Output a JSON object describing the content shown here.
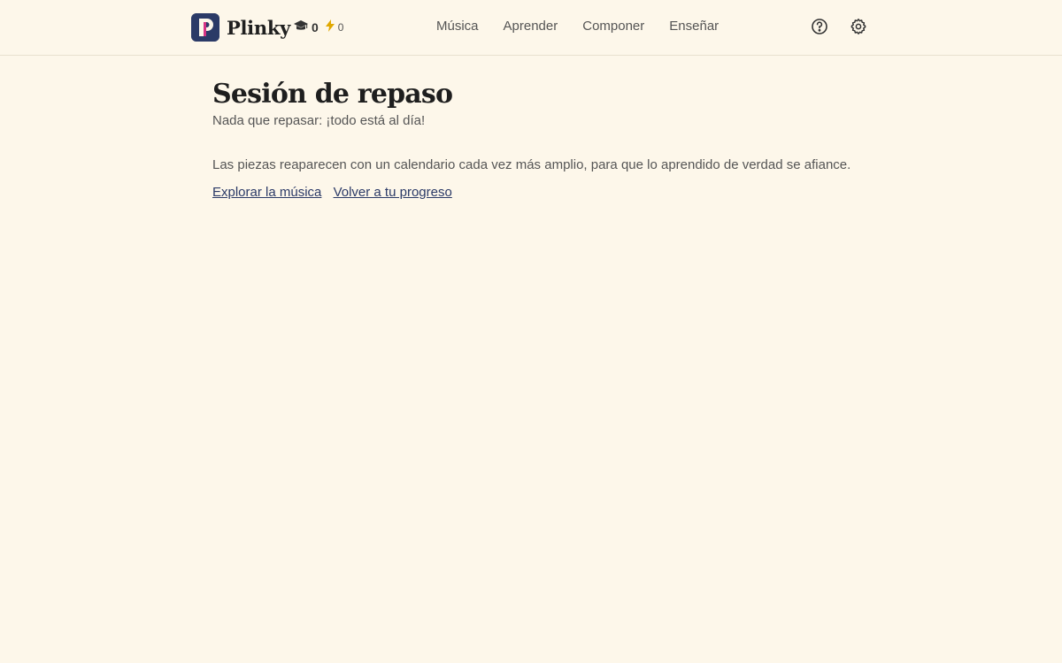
{
  "header": {
    "brand": "Plinky",
    "stats": {
      "learned_count": "0",
      "energy_count": "0"
    },
    "nav": [
      {
        "label": "Música"
      },
      {
        "label": "Aprender"
      },
      {
        "label": "Componer"
      },
      {
        "label": "Enseñar"
      }
    ],
    "icons": {
      "help": "help-circle-icon",
      "settings": "gear-icon"
    }
  },
  "main": {
    "title": "Sesión de repaso",
    "subtitle": "Nada que repasar: ¡todo está al día!",
    "info": "Las piezas reaparecen con un calendario cada vez más amplio, para que lo aprendido de verdad se afiance.",
    "links": {
      "explore": "Explorar la música",
      "progress": "Volver a tu progreso"
    }
  },
  "colors": {
    "background": "#fdf7ea",
    "brand": "#2b3a67",
    "brand_accent": "#d63384",
    "link": "#2b3a67"
  }
}
